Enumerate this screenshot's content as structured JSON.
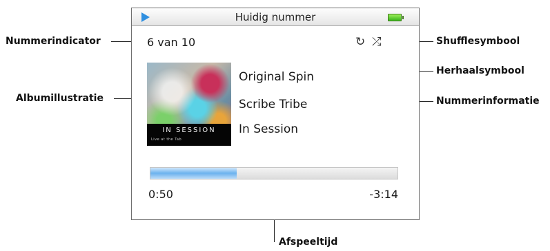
{
  "screen": {
    "title": "Huidig nummer",
    "track_counter": "6 van 10",
    "song": "Original Spin",
    "artist": "Scribe Tribe",
    "album": "In Session",
    "artwork_text": "IN SESSION",
    "artwork_subtext": "Live at the Tab",
    "elapsed": "0:50",
    "remaining": "-3:14",
    "progress_fraction": 0.35,
    "icons": {
      "play": "play-icon",
      "battery": "battery-icon",
      "repeat": "repeat-icon",
      "shuffle": "shuffle-icon"
    }
  },
  "callouts": {
    "track_indicator": "Nummerindicator",
    "album_art": "Albumillustratie",
    "shuffle": "Shufflesymbool",
    "repeat": "Herhaalsymbool",
    "song_info": "Nummerinformatie",
    "playtime": "Afspeeltijd"
  },
  "colors": {
    "play_icon": "#2f8fe0",
    "battery": "#38b41c",
    "progress_fill": "#6cb2ee"
  }
}
